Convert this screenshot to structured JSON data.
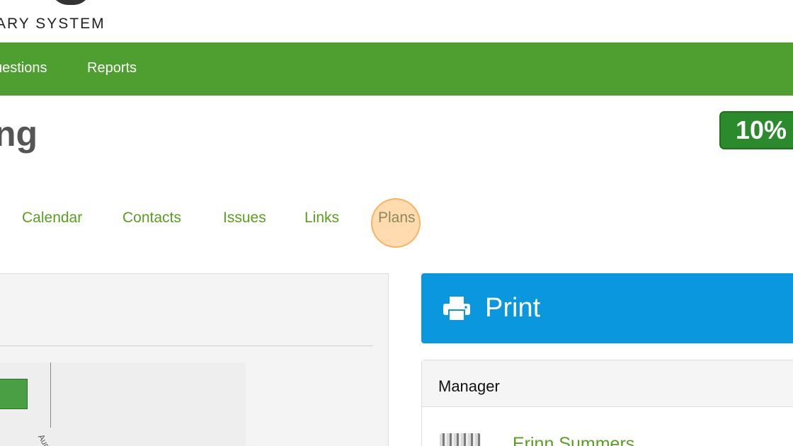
{
  "brand": {
    "subtitle": "ARY SYSTEM"
  },
  "topnav": {
    "items": [
      {
        "label": "uestions"
      },
      {
        "label": "Reports"
      }
    ]
  },
  "header": {
    "title": "ng",
    "progress": "10%"
  },
  "tabs": {
    "items": [
      {
        "label": "Calendar"
      },
      {
        "label": "Contacts"
      },
      {
        "label": "Issues"
      },
      {
        "label": "Links"
      },
      {
        "label": "Plans",
        "active": true
      }
    ]
  },
  "chart": {
    "tick_label": "Aug"
  },
  "print": {
    "label": "Print",
    "icon": "printer-icon"
  },
  "manager": {
    "title": "Manager",
    "name": "Erinn Summers"
  },
  "colors": {
    "nav_green": "#4f9e30",
    "badge_green": "#2b8a2b",
    "link_green": "#5a9e1f",
    "print_blue": "#0a97dd"
  }
}
